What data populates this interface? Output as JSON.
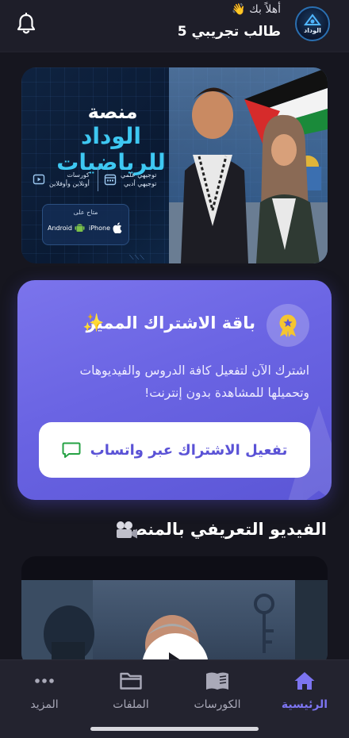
{
  "header": {
    "greeting": "أهلاً بك 👋",
    "user_name": "طالب تجريبي 5",
    "logo_text": "الوداد"
  },
  "hero": {
    "title_line1": "منصة",
    "title_line2": "الوداد للرياضيات",
    "feature_1": "توجيهي علمي\nتوجيهي أدبي",
    "feature_2": "كورسات\nأونلاين وأوفلاين",
    "available_on": "متاح على",
    "store_ios": "iPhone",
    "store_android": "Android"
  },
  "subscription": {
    "title": "باقة الاشتراك المميز",
    "sparkle": "✨",
    "description": "اشترك الآن لتفعيل كافة الدروس والفيديوهات وتحميلها للمشاهدة بدون إنترنت!",
    "button_label": "تفعيل الاشتراك عبر واتساب"
  },
  "intro_video": {
    "title": "الفيديو التعريفي بالمنصة"
  },
  "bottom_nav": {
    "items": [
      {
        "label": "الرئيسية",
        "icon": "home-icon",
        "active": true
      },
      {
        "label": "الكورسات",
        "icon": "book-icon",
        "active": false
      },
      {
        "label": "الملفات",
        "icon": "folder-icon",
        "active": false
      },
      {
        "label": "المزيد",
        "icon": "more-icon",
        "active": false
      }
    ]
  },
  "colors": {
    "background": "#16161f",
    "accent": "#7c74f0",
    "subscription_card": "#6a64e3",
    "hero_title_accent": "#3ec8f2",
    "whatsapp_icon": "#25a244"
  }
}
